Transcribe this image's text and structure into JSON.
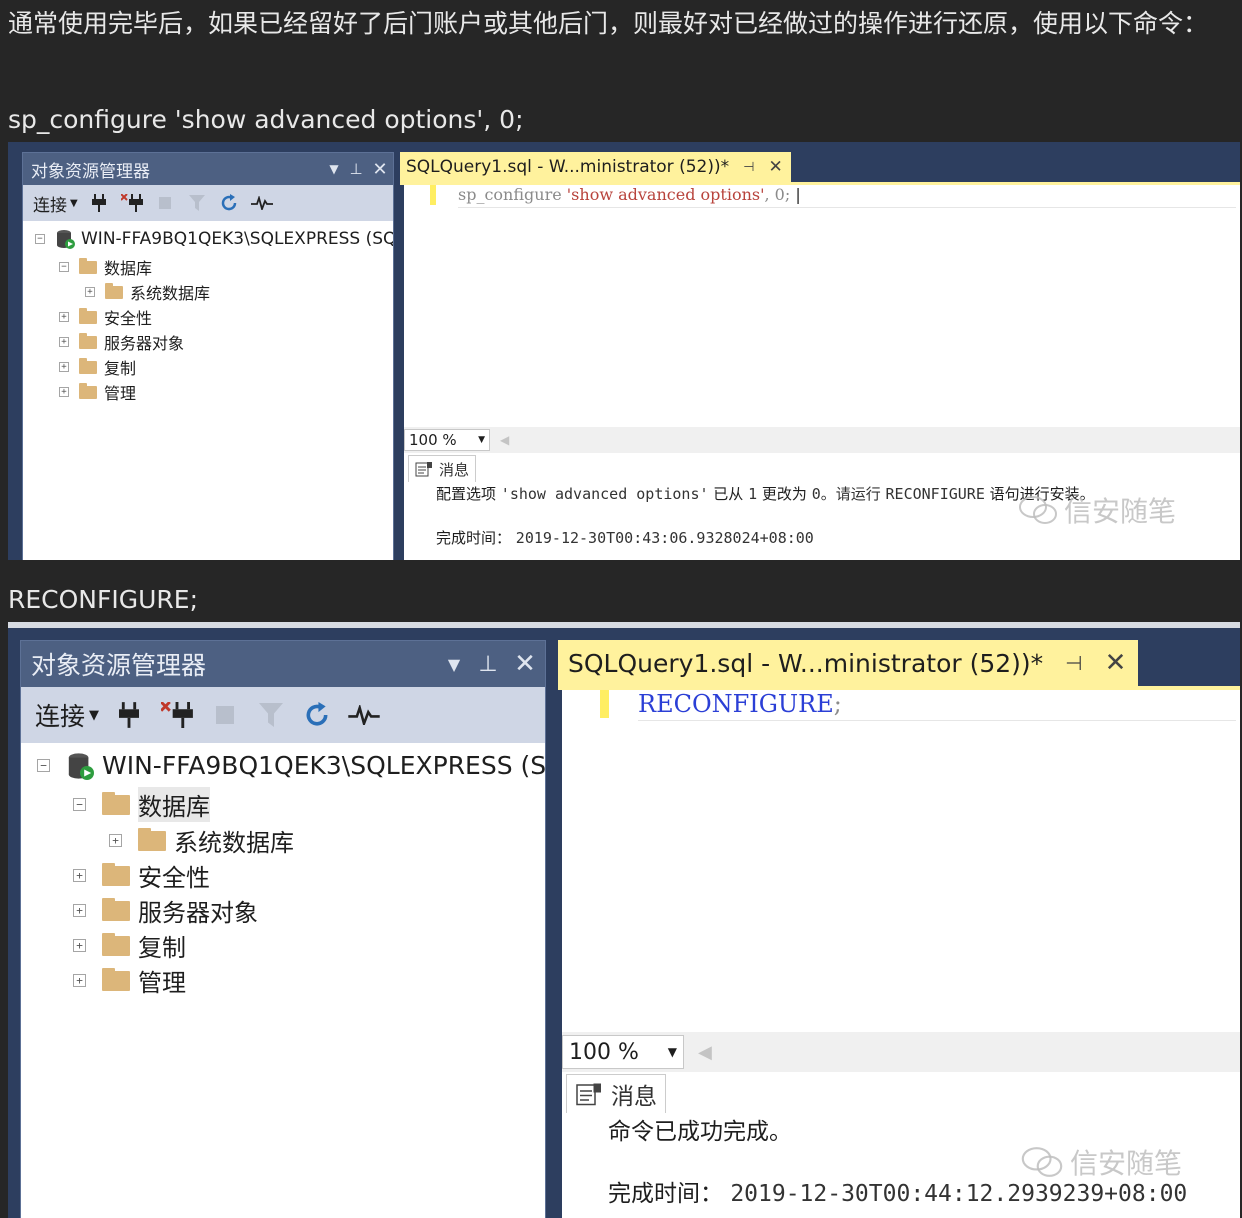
{
  "article": {
    "para1": "通常使用完毕后，如果已经留好了后门账户或其他后门，则最好对已经做过的操作进行还原，使用以下命令：",
    "para2": "sp_configure 'show advanced options', 0;",
    "para3": "RECONFIGURE;"
  },
  "screenshots": [
    {
      "explorer": {
        "title": "对象资源管理器",
        "pin_icon": "pin-icon",
        "close_icon": "close-icon",
        "toolbar": {
          "connect_label": "连接",
          "icons": [
            "connect-plug-icon",
            "disconnect-plug-icon",
            "stop-icon",
            "filter-icon",
            "refresh-icon",
            "activity-monitor-icon"
          ]
        },
        "server": "WIN-FFA9BQ1QEK3\\SQLEXPRESS (SQ",
        "nodes": {
          "databases": "数据库",
          "system_databases": "系统数据库",
          "security": "安全性",
          "server_objects": "服务器对象",
          "replication": "复制",
          "management": "管理"
        }
      },
      "query_tab": {
        "title": "SQLQuery1.sql - W...ministrator (52))*"
      },
      "code": {
        "fn": "sp_configure",
        "str": "'show advanced options'",
        "tail": ", 0;"
      },
      "zoom": "100 %",
      "messages": {
        "tab_label": "消息",
        "line1_a": "配置选项",
        "line1_b": "'show advanced options'",
        "line1_c": "已从",
        "line1_d": "1",
        "line1_e": "更改为",
        "line1_f": "0。请运行",
        "line1_g": "RECONFIGURE",
        "line1_h": "语句进行安装。",
        "line2_label": "完成时间：",
        "line2_value": "2019-12-30T00:43:06.9328024+08:00"
      },
      "watermark": "信安随笔"
    },
    {
      "explorer": {
        "title": "对象资源管理器",
        "toolbar": {
          "connect_label": "连接"
        },
        "server": "WIN-FFA9BQ1QEK3\\SQLEXPRESS (SQ",
        "nodes": {
          "databases": "数据库",
          "system_databases": "系统数据库",
          "security": "安全性",
          "server_objects": "服务器对象",
          "replication": "复制",
          "management": "管理"
        }
      },
      "query_tab": {
        "title": "SQLQuery1.sql - W...ministrator (52))*"
      },
      "code": {
        "kw": "RECONFIGURE",
        "tail": ";"
      },
      "zoom": "100 %",
      "messages": {
        "tab_label": "消息",
        "line1": "命令已成功完成。",
        "line2_label": "完成时间：",
        "line2_value": "2019-12-30T00:44:12.2939239+08:00"
      },
      "watermark": "信安随笔"
    }
  ],
  "colors": {
    "page_bg": "#262626",
    "ssms_frame": "#2d3e5f",
    "panel_title": "#4d6082",
    "toolbar": "#cfd6e5",
    "tab_active": "#fff29d",
    "folder": "#dcb67a"
  }
}
